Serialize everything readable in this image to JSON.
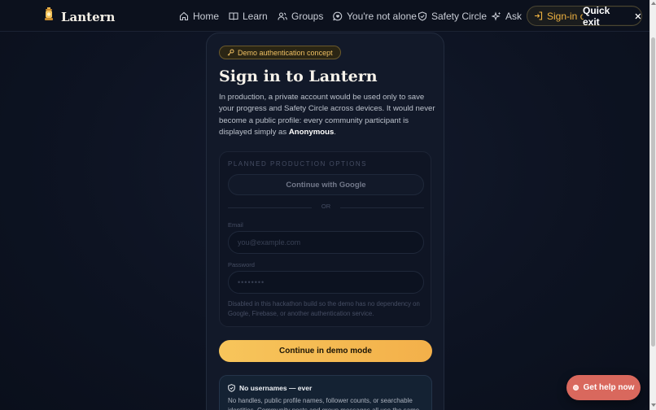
{
  "header": {
    "brand": "Lantern",
    "nav": [
      {
        "label": "Home",
        "icon": "home-icon"
      },
      {
        "label": "Learn",
        "icon": "book-icon"
      },
      {
        "label": "Groups",
        "icon": "users-icon"
      },
      {
        "label": "You're not alone",
        "icon": "chat-heart-icon"
      },
      {
        "label": "Safety Circle",
        "icon": "shield-icon"
      },
      {
        "label": "Ask",
        "icon": "sparkle-icon"
      }
    ],
    "signin_label": "Sign-in co",
    "quick_exit": "Quick exit",
    "accent": "#f1b441"
  },
  "card": {
    "badge": "Demo authentication concept",
    "title": "Sign in to Lantern",
    "desc_prefix": "In production, a private account would be used only to save your progress and Safety Circle across devices. It would never become a public profile: every community participant is displayed simply as ",
    "desc_bold": "Anonymous",
    "desc_suffix": ".",
    "options": {
      "heading": "PLANNED PRODUCTION OPTIONS",
      "google": "Continue with Google",
      "or": "OR",
      "email_label": "Email",
      "email_placeholder": "you@example.com",
      "password_label": "Password",
      "password_placeholder": "••••••••",
      "note": "Disabled in this hackathon build so the demo has no dependency on Google, Firebase, or another authentication service."
    },
    "demo_button": "Continue in demo mode",
    "notice": {
      "title": "No usernames — ever",
      "body": "No handles, public profile names, follower counts, or searchable identities. Community posts and group messages all use the same"
    }
  },
  "help_button": "Get help now",
  "colors": {
    "background": "#0d1322",
    "card": "#121929",
    "cta": "#f7c55b",
    "help": "#d9685d"
  }
}
